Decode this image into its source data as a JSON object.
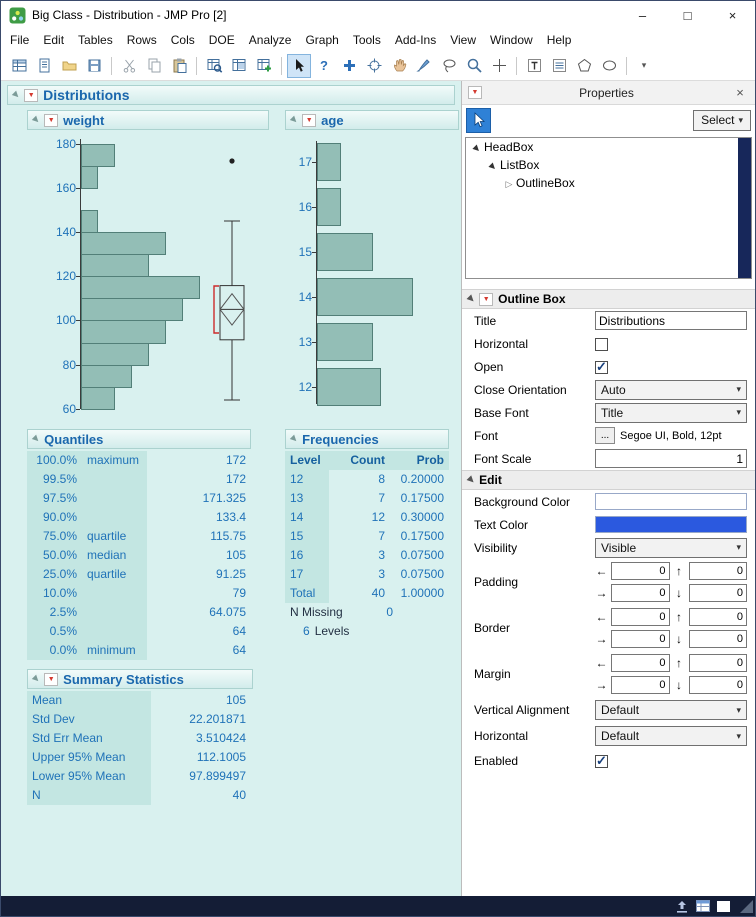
{
  "window": {
    "title": "Big Class - Distribution - JMP Pro [2]",
    "minimize": "–",
    "maximize": "□",
    "close": "×"
  },
  "menu": {
    "items": [
      "File",
      "Edit",
      "Tables",
      "Rows",
      "Cols",
      "DOE",
      "Analyze",
      "Graph",
      "Tools",
      "Add-Ins",
      "View",
      "Window",
      "Help"
    ]
  },
  "toolbar": {
    "icons": [
      "new-data-table-icon",
      "new-journal-icon",
      "open-icon",
      "save-icon",
      "separator",
      "cut-icon",
      "copy-icon",
      "paste-icon",
      "separator",
      "table-find-icon",
      "table-summary-icon",
      "table-add-icon",
      "separator",
      "arrow-cursor-icon",
      "help-icon",
      "fat-plus-icon",
      "crosshair-icon",
      "grabber-hand-icon",
      "brush-icon",
      "lasso-icon",
      "magnifier-icon",
      "annotate-plus-icon",
      "separator",
      "text-box-icon",
      "scroller-icon",
      "polygon-icon",
      "oval-icon",
      "separator",
      "toolbar-overflow-icon"
    ]
  },
  "report": {
    "root_title": "Distributions",
    "panels": [
      {
        "title": "weight"
      },
      {
        "title": "age"
      }
    ],
    "quantiles": {
      "title": "Quantiles",
      "rows": [
        {
          "pct": "100.0%",
          "label": "maximum",
          "value": "172"
        },
        {
          "pct": "99.5%",
          "label": "",
          "value": "172"
        },
        {
          "pct": "97.5%",
          "label": "",
          "value": "171.325"
        },
        {
          "pct": "90.0%",
          "label": "",
          "value": "133.4"
        },
        {
          "pct": "75.0%",
          "label": "quartile",
          "value": "115.75"
        },
        {
          "pct": "50.0%",
          "label": "median",
          "value": "105"
        },
        {
          "pct": "25.0%",
          "label": "quartile",
          "value": "91.25"
        },
        {
          "pct": "10.0%",
          "label": "",
          "value": "79"
        },
        {
          "pct": "2.5%",
          "label": "",
          "value": "64.075"
        },
        {
          "pct": "0.5%",
          "label": "",
          "value": "64"
        },
        {
          "pct": "0.0%",
          "label": "minimum",
          "value": "64"
        }
      ]
    },
    "frequencies": {
      "title": "Frequencies",
      "headers": [
        "Level",
        "Count",
        "Prob"
      ],
      "rows": [
        {
          "level": "12",
          "count": "8",
          "prob": "0.20000"
        },
        {
          "level": "13",
          "count": "7",
          "prob": "0.17500"
        },
        {
          "level": "14",
          "count": "12",
          "prob": "0.30000"
        },
        {
          "level": "15",
          "count": "7",
          "prob": "0.17500"
        },
        {
          "level": "16",
          "count": "3",
          "prob": "0.07500"
        },
        {
          "level": "17",
          "count": "3",
          "prob": "0.07500"
        },
        {
          "level": "Total",
          "count": "40",
          "prob": "1.00000"
        }
      ],
      "n_missing_label": "N Missing",
      "n_missing_value": "0",
      "levels_value": "6",
      "levels_label": "Levels"
    },
    "summary": {
      "title": "Summary Statistics",
      "rows": [
        {
          "label": "Mean",
          "value": "105"
        },
        {
          "label": "Std Dev",
          "value": "22.201871"
        },
        {
          "label": "Std Err Mean",
          "value": "3.510424"
        },
        {
          "label": "Upper 95% Mean",
          "value": "112.1005"
        },
        {
          "label": "Lower 95% Mean",
          "value": "97.899497"
        },
        {
          "label": "N",
          "value": "40"
        }
      ]
    }
  },
  "chart_data": [
    {
      "type": "bar",
      "name": "weight-histogram",
      "orientation": "horizontal",
      "variable": "weight",
      "axis_range": [
        60,
        180
      ],
      "axis_ticks": [
        60,
        80,
        100,
        120,
        140,
        160,
        180
      ],
      "bins": [
        {
          "from": 60,
          "to": 70,
          "count": 2
        },
        {
          "from": 70,
          "to": 80,
          "count": 3
        },
        {
          "from": 80,
          "to": 90,
          "count": 4
        },
        {
          "from": 90,
          "to": 100,
          "count": 5
        },
        {
          "from": 100,
          "to": 110,
          "count": 6
        },
        {
          "from": 110,
          "to": 120,
          "count": 7
        },
        {
          "from": 120,
          "to": 130,
          "count": 4
        },
        {
          "from": 130,
          "to": 140,
          "count": 5
        },
        {
          "from": 140,
          "to": 150,
          "count": 1
        },
        {
          "from": 150,
          "to": 160,
          "count": 0
        },
        {
          "from": 160,
          "to": 170,
          "count": 1
        },
        {
          "from": 170,
          "to": 180,
          "count": 2
        }
      ],
      "bin_counts_note": "counts estimated from bar lengths; total N = 40",
      "boxplot": {
        "whisker_low": 64,
        "q1": 91.25,
        "median": 105,
        "q3": 115.75,
        "whisker_high": 145,
        "mean_ci_low": 97.899497,
        "mean_ci_high": 112.1005,
        "outliers": [
          172
        ]
      }
    },
    {
      "type": "bar",
      "name": "age-histogram",
      "orientation": "horizontal",
      "variable": "age",
      "axis_ticks": [
        12,
        13,
        14,
        15,
        16,
        17
      ],
      "categories": [
        "12",
        "13",
        "14",
        "15",
        "16",
        "17"
      ],
      "values": [
        8,
        7,
        12,
        7,
        3,
        3
      ]
    }
  ],
  "properties": {
    "panel_title": "Properties",
    "close": "×",
    "select_button": "Select",
    "tree": {
      "items": [
        {
          "label": "HeadBox",
          "depth": 0,
          "expanded": true
        },
        {
          "label": "ListBox",
          "depth": 1,
          "expanded": true
        },
        {
          "label": "OutlineBox",
          "depth": 2,
          "expanded": false
        }
      ]
    },
    "outline_box": {
      "section_title": "Outline Box",
      "rows": {
        "title": {
          "label": "Title",
          "value": "Distributions"
        },
        "horizontal": {
          "label": "Horizontal",
          "checked": false
        },
        "open": {
          "label": "Open",
          "checked": true
        },
        "close_orientation": {
          "label": "Close Orientation",
          "value": "Auto"
        },
        "base_font": {
          "label": "Base Font",
          "value": "Title"
        },
        "font": {
          "label": "Font",
          "button": "...",
          "value": "Segoe UI, Bold, 12pt"
        },
        "font_scale": {
          "label": "Font Scale",
          "value": "1"
        }
      }
    },
    "edit": {
      "section_title": "Edit",
      "background_color_label": "Background Color",
      "text_color_label": "Text Color",
      "text_color_value": "#2b59df",
      "visibility": {
        "label": "Visibility",
        "value": "Visible"
      },
      "padding": {
        "label": "Padding",
        "values": [
          "0",
          "0",
          "0",
          "0"
        ]
      },
      "border": {
        "label": "Border",
        "values": [
          "0",
          "0",
          "0",
          "0"
        ]
      },
      "margin": {
        "label": "Margin",
        "values": [
          "0",
          "0",
          "0",
          "0"
        ]
      },
      "vertical_alignment": {
        "label": "Vertical Alignment",
        "value": "Default"
      },
      "horizontal": {
        "label": "Horizontal",
        "value": "Default"
      },
      "enabled": {
        "label": "Enabled",
        "checked": true
      }
    }
  },
  "colors": {
    "report_background": "#d9f1ef",
    "outline_title_blue": "#1a67ad",
    "table_text_blue": "#1f72b8",
    "bar_fill": "#93beb6",
    "bar_border": "#527f78",
    "sh aded_cell": "#c3e6e2"
  }
}
